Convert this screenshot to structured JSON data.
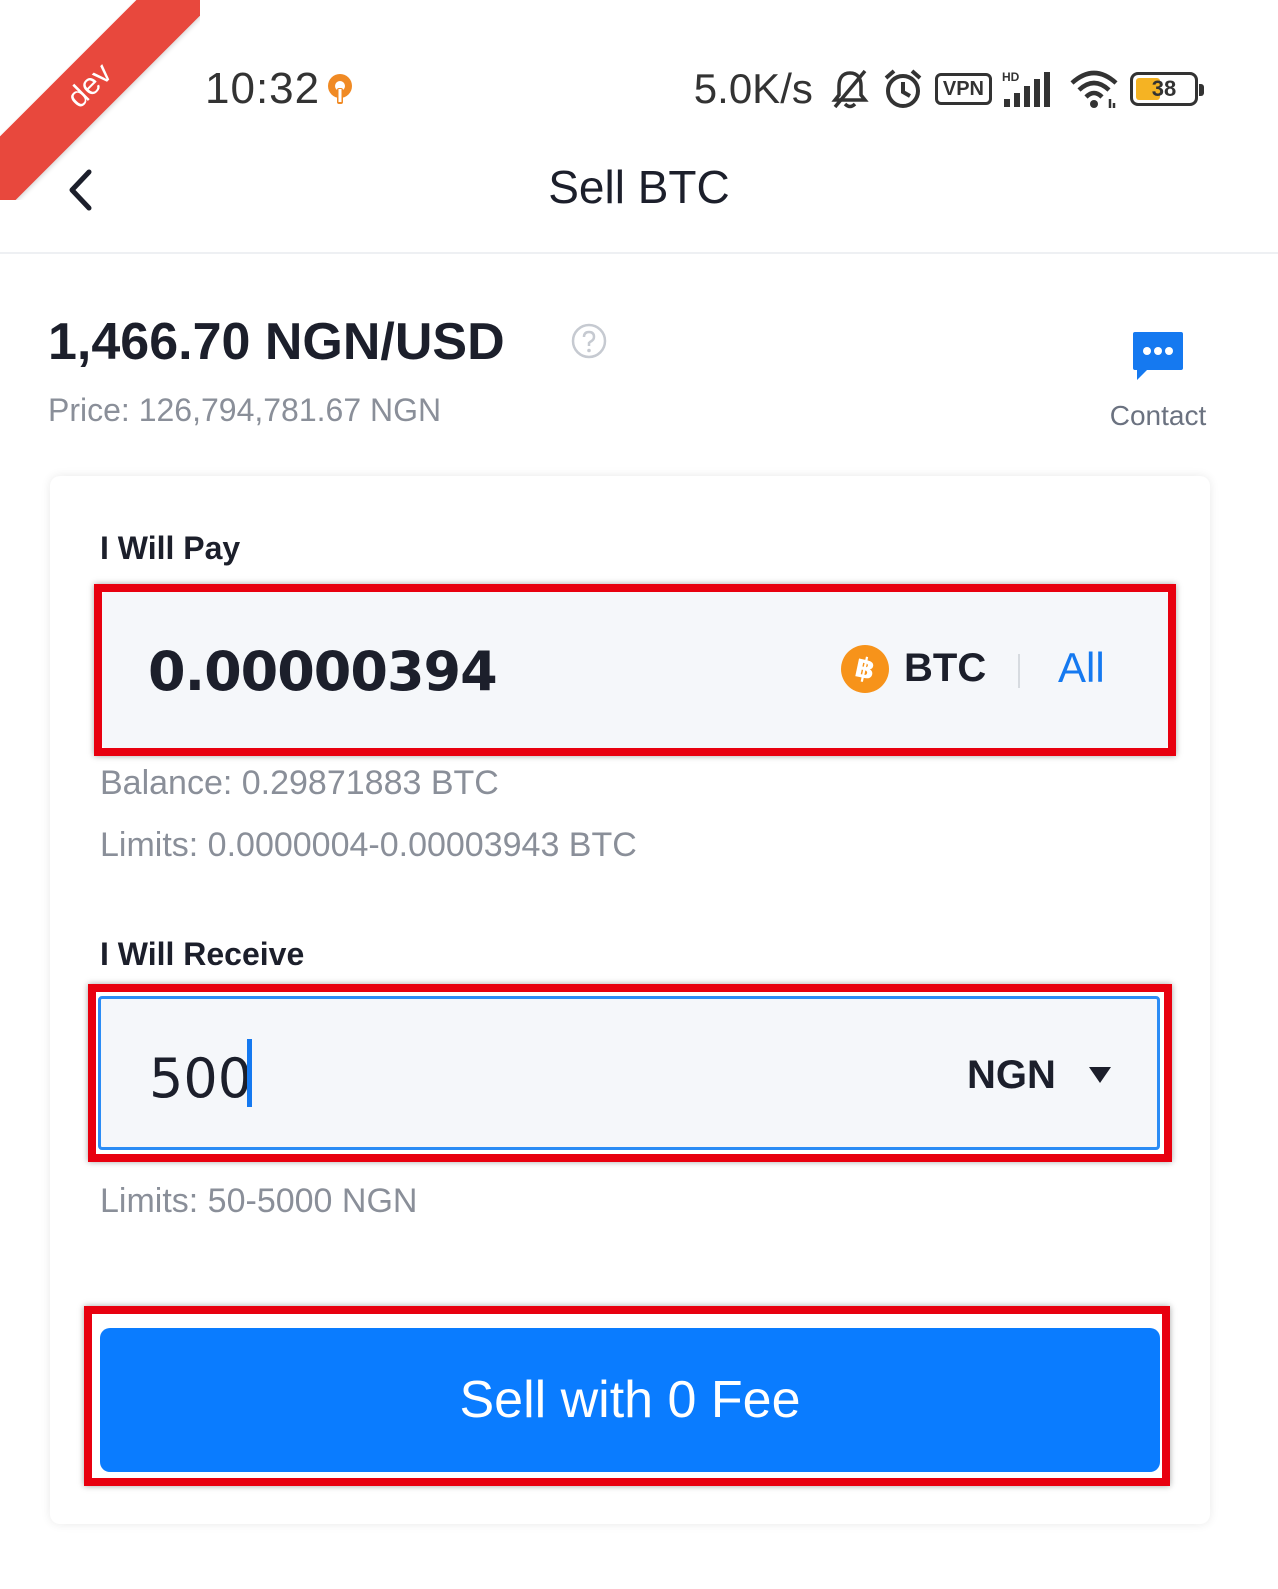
{
  "status_bar": {
    "time": "10:32",
    "speed": "5.0K/s",
    "vpn": "VPN",
    "battery": "38",
    "icons": [
      "vpn-key-icon",
      "mute-bell-icon",
      "alarm-icon",
      "vpn-icon",
      "signal-icon",
      "wifi-icon",
      "battery-icon"
    ]
  },
  "ribbon": {
    "label": "dev",
    "color": "#e8483d"
  },
  "header": {
    "title": "Sell BTC",
    "back_icon": "chevron-left-icon"
  },
  "rate": {
    "value": "1,466.70 NGN/USD",
    "help_icon": "help-circle-icon",
    "price": "Price: 126,794,781.67 NGN"
  },
  "contact": {
    "label": "Contact",
    "icon": "chat-bubble-icon",
    "color": "#1579f0"
  },
  "pay": {
    "label": "I Will Pay",
    "value": "0.00000394",
    "currency": "BTC",
    "coin_icon": "bitcoin-icon",
    "all_label": "All",
    "balance": "Balance: 0.29871883 BTC",
    "limits": "Limits: 0.0000004-0.00003943 BTC"
  },
  "receive": {
    "label": "I Will Receive",
    "value": "500",
    "currency": "NGN",
    "dropdown_icon": "caret-down-icon",
    "limits": "Limits: 50-5000 NGN"
  },
  "sell_button": {
    "label": "Sell with 0 Fee",
    "color": "#0a7cff"
  },
  "highlight_color": "#e8000f"
}
